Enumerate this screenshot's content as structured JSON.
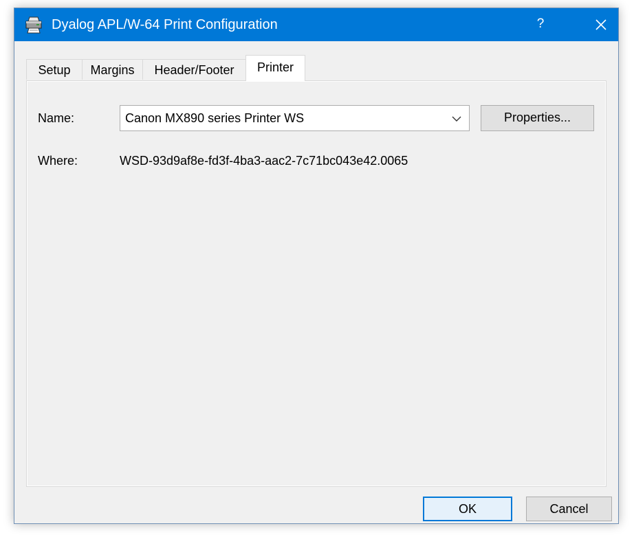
{
  "window": {
    "title": "Dyalog APL/W-64 Print Configuration",
    "help_label": "?",
    "title_icon": "printer-icon",
    "close_icon": "close-icon"
  },
  "tabs": [
    {
      "label": "Setup",
      "active": false
    },
    {
      "label": "Margins",
      "active": false
    },
    {
      "label": "Header/Footer",
      "active": false
    },
    {
      "label": "Printer",
      "active": true
    }
  ],
  "printer": {
    "name_label": "Name:",
    "selected_printer": "Canon MX890 series Printer WS",
    "properties_label": "Properties...",
    "where_label": "Where:",
    "where_value": "WSD-93d9af8e-fd3f-4ba3-aac2-7c71bc043e42.0065"
  },
  "footer": {
    "ok_label": "OK",
    "cancel_label": "Cancel"
  },
  "colors": {
    "title_bar": "#0078d7",
    "dialog_background": "#f0f0f0",
    "default_button_border": "#0078d7"
  }
}
